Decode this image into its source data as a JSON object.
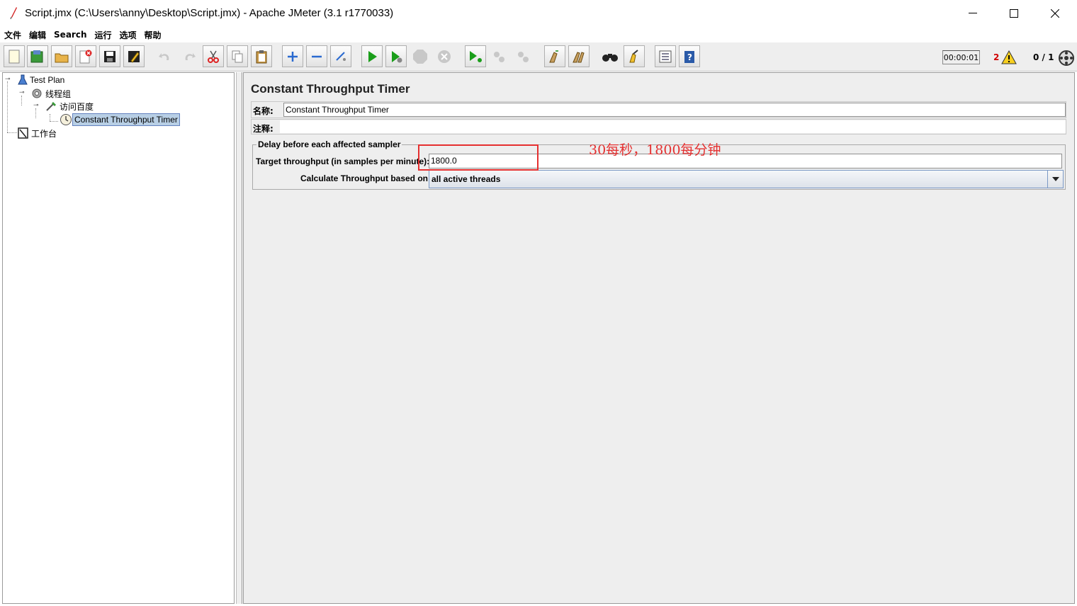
{
  "window": {
    "title": "Script.jmx (C:\\Users\\anny\\Desktop\\Script.jmx) - Apache JMeter (3.1 r1770033)"
  },
  "menu": [
    "文件",
    "编辑",
    "Search",
    "运行",
    "选项",
    "帮助"
  ],
  "toolbar": {
    "icons": [
      "new-icon",
      "templates-icon",
      "open-icon",
      "close-icon",
      "save-icon",
      "save-as-icon",
      "undo-icon",
      "redo-icon",
      "cut-icon",
      "copy-icon",
      "paste-icon",
      "expand-icon",
      "collapse-icon",
      "toggle-icon",
      "start-icon",
      "start-no-pause-icon",
      "stop-icon",
      "shutdown-icon",
      "remote-start-icon",
      "remote-stop-icon",
      "remote-shutdown-icon",
      "clear-icon",
      "clear-all-icon",
      "search-icon",
      "reset-search-icon",
      "function-helper-icon",
      "help-icon"
    ],
    "elapsed_time": "00:00:01",
    "warning_count": "2",
    "threads": "0 / 1"
  },
  "tree": {
    "nodes": [
      {
        "label": "Test Plan",
        "icon": "test-plan-icon"
      },
      {
        "label": "线程组",
        "icon": "thread-group-icon"
      },
      {
        "label": "访问百度",
        "icon": "sampler-icon"
      },
      {
        "label": "Constant Throughput Timer",
        "icon": "timer-icon",
        "selected": true
      },
      {
        "label": "工作台",
        "icon": "workbench-icon"
      }
    ]
  },
  "editor": {
    "title": "Constant Throughput Timer",
    "name_label": "名称:",
    "name_value": "Constant Throughput Timer",
    "comment_label": "注释:",
    "comment_value": "",
    "group_title": "Delay before each affected sampler",
    "target_label": "Target throughput (in samples per minute):",
    "target_value": "1800.0",
    "calc_label": "Calculate Throughput based on:",
    "calc_value": "all active threads"
  },
  "annotation": {
    "text": "30每秒，1800每分钟",
    "color": "#e53030"
  }
}
